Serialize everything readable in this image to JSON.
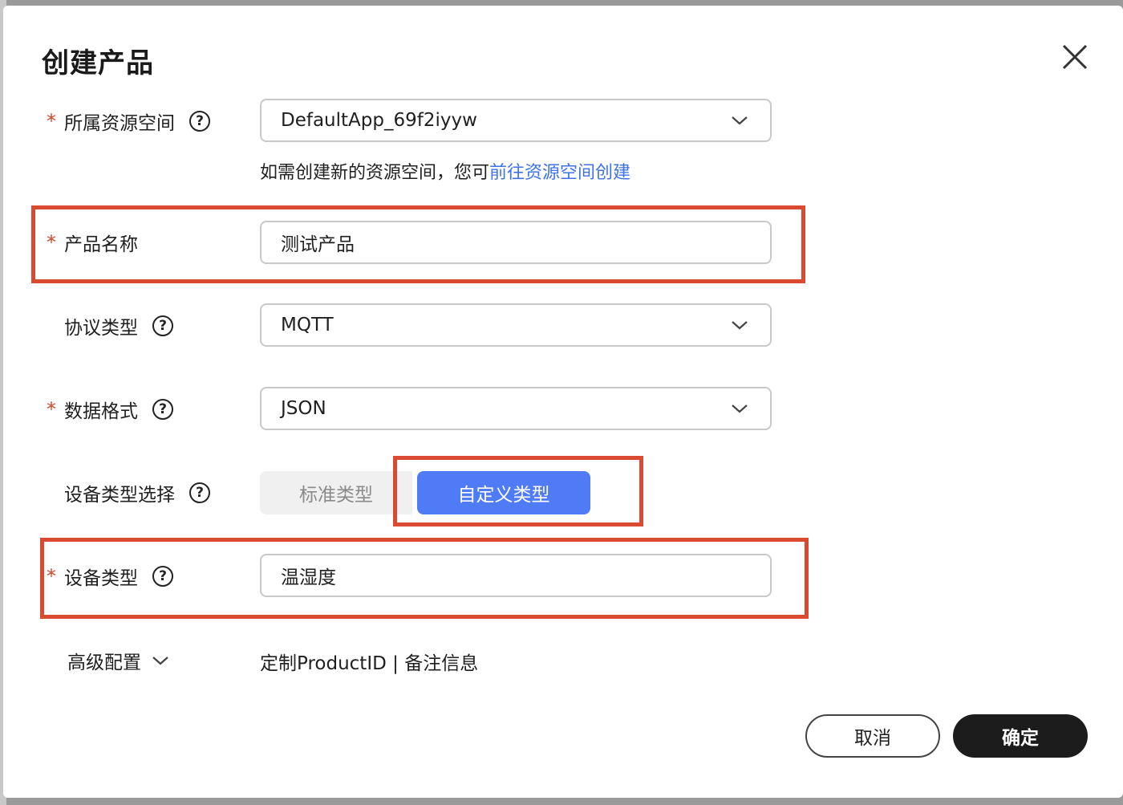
{
  "dialog": {
    "title": "创建产品",
    "close_icon": "close-icon"
  },
  "form": {
    "required_mark": "*",
    "help_mark": "?",
    "resource_space": {
      "label": "所属资源空间",
      "value": "DefaultApp_69f2iyyw",
      "hint_prefix": "如需创建新的资源空间，您可",
      "hint_link": "前往资源空间创建"
    },
    "product_name": {
      "label": "产品名称",
      "value": "测试产品"
    },
    "protocol": {
      "label": "协议类型",
      "value": "MQTT"
    },
    "data_format": {
      "label": "数据格式",
      "value": "JSON"
    },
    "device_type_select": {
      "label": "设备类型选择",
      "options": [
        "标准类型",
        "自定义类型"
      ],
      "selected": "自定义类型"
    },
    "device_type": {
      "label": "设备类型",
      "value": "温湿度"
    },
    "advanced": {
      "label": "高级配置",
      "summary": "定制ProductID | 备注信息"
    }
  },
  "buttons": {
    "cancel": "取消",
    "confirm": "确定"
  },
  "colors": {
    "required": "#d9432b",
    "link": "#3f72e8",
    "segment_active": "#4f7cf6",
    "annotation_box": "#d94a30",
    "confirm_button": "#1c1c1c"
  }
}
